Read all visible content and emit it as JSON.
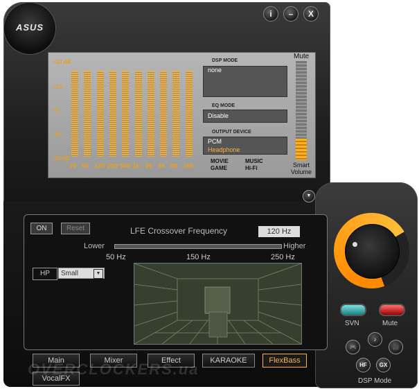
{
  "brand": {
    "logo": "ASUS"
  },
  "window_buttons": {
    "info": "i",
    "minimize": "–",
    "close": "X"
  },
  "equalizer": {
    "db_labels": [
      "+20 dB",
      "+10",
      "+0",
      "-10",
      "-20 dB"
    ],
    "bands": [
      {
        "freq": "30",
        "level": 0.9
      },
      {
        "freq": "60",
        "level": 0.9
      },
      {
        "freq": "120",
        "level": 0.9
      },
      {
        "freq": "250",
        "level": 0.9
      },
      {
        "freq": "500",
        "level": 0.9
      },
      {
        "freq": "1k",
        "level": 0.9
      },
      {
        "freq": "2k",
        "level": 0.9
      },
      {
        "freq": "4k",
        "level": 0.9
      },
      {
        "freq": "8k",
        "level": 0.9
      },
      {
        "freq": "16k",
        "level": 0.9
      }
    ]
  },
  "dsp_mode": {
    "title": "DSP MODE",
    "value": "none"
  },
  "eq_mode": {
    "title": "EQ MODE",
    "value": "Disable"
  },
  "output_device": {
    "title": "OUTPUT DEVICE",
    "line1": "PCM",
    "line2": "Headphone"
  },
  "mode_labels": {
    "movie": "MOVIE",
    "game": "GAME",
    "music": "MUSIC",
    "hifi": "Hi-Fi"
  },
  "volume": {
    "mute_label": "Mute",
    "smart_label_1": "Smart",
    "smart_label_2": "Volume",
    "level": 0.22
  },
  "flexbass": {
    "on_label": "ON",
    "reset_label": "Reset",
    "crossover_label": "LFE Crossover Frequency",
    "crossover_value": "120 Hz",
    "lower_label": "Lower",
    "higher_label": "Higher",
    "tick_50": "50 Hz",
    "tick_150": "150 Hz",
    "tick_250": "250 Hz",
    "hp_label": "HP",
    "hp_select": "Small"
  },
  "tabs": [
    "Main",
    "Mixer",
    "Effect",
    "KARAOKE",
    "FlexBass",
    "VocalFX"
  ],
  "active_tab": "FlexBass",
  "right_controls": {
    "svn_label": "SVN",
    "mute_label": "Mute",
    "dsp_mode_label": "DSP Mode",
    "hf": "HF",
    "gx": "GX"
  },
  "watermark": "OVERCLOCKERS.ua",
  "colors": {
    "accent": "#f0a020",
    "display_bg": "#a8a8a8",
    "svn": "#2aa6a6",
    "mute": "#d02020"
  }
}
